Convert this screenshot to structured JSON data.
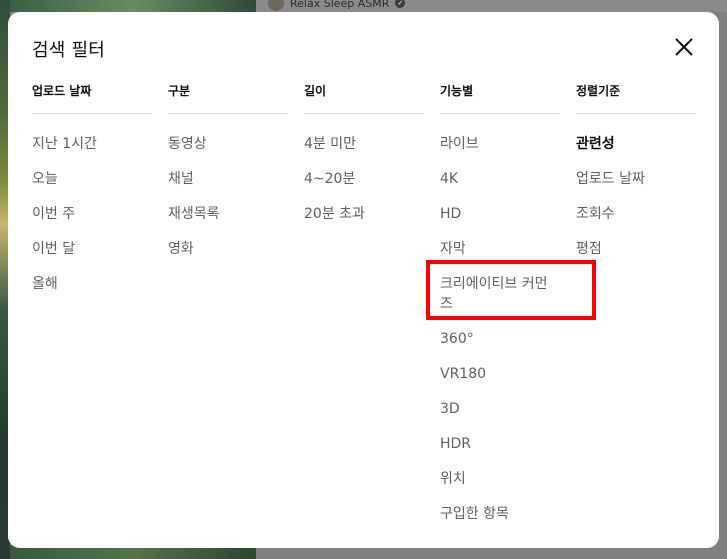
{
  "background": {
    "channel_name": "Relax Sleep ASMR"
  },
  "dialog": {
    "title": "검색 필터",
    "columns": [
      {
        "header": "업로드 날짜",
        "items": [
          "지난 1시간",
          "오늘",
          "이번 주",
          "이번 달",
          "올해"
        ]
      },
      {
        "header": "구분",
        "items": [
          "동영상",
          "채널",
          "재생목록",
          "영화"
        ]
      },
      {
        "header": "길이",
        "items": [
          "4분 미만",
          "4~20분",
          "20분 초과"
        ]
      },
      {
        "header": "기능별",
        "items": [
          "라이브",
          "4K",
          "HD",
          "자막",
          "크리에이티브 커먼즈",
          "360°",
          "VR180",
          "3D",
          "HDR",
          "위치",
          "구입한 항목"
        ]
      },
      {
        "header": "정렬기준",
        "items": [
          "관련성",
          "업로드 날짜",
          "조회수",
          "평점"
        ],
        "selected": "관련성"
      }
    ],
    "highlight_color": "#ff0000"
  }
}
